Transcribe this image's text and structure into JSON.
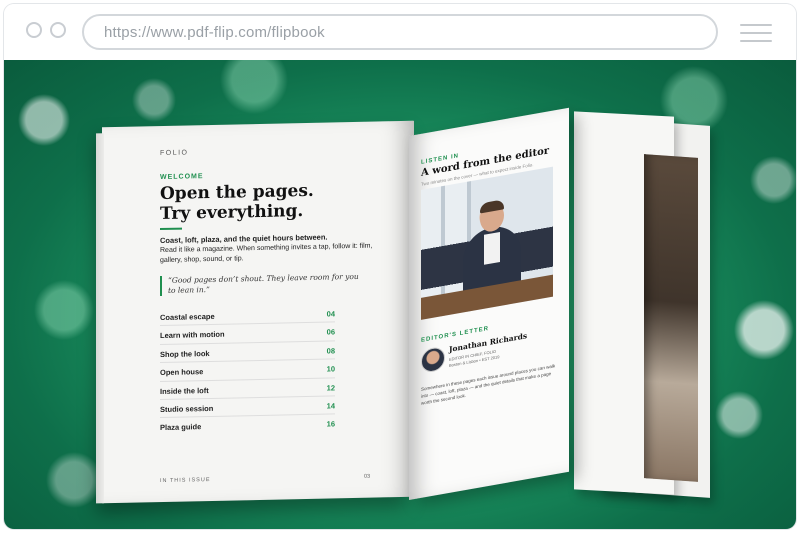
{
  "browser": {
    "url": "https://www.pdf-flip.com/flipbook"
  },
  "flipbook": {
    "left_page": {
      "brand": "FOLIO",
      "kicker": "WELCOME",
      "headline_line1": "Open the pages.",
      "headline_line2": "Try everything.",
      "deck_bold": "Coast, loft, plaza, and the quiet hours between.",
      "deck_body": "Read it like a magazine. When something invites a tap, follow it: film, gallery, shop, sound, or tip.",
      "quote": "“Good pages don’t shout. They leave room for you to lean in.”",
      "toc": [
        {
          "title": "Coastal escape",
          "page": "04"
        },
        {
          "title": "Learn with motion",
          "page": "06"
        },
        {
          "title": "Shop the look",
          "page": "08"
        },
        {
          "title": "Open house",
          "page": "10"
        },
        {
          "title": "Inside the loft",
          "page": "12"
        },
        {
          "title": "Studio session",
          "page": "14"
        },
        {
          "title": "Plaza guide",
          "page": "16"
        }
      ],
      "footer_label": "IN THIS ISSUE",
      "page_number": "03"
    },
    "right_page": {
      "kicker": "LISTEN IN",
      "title": "A word from the editor",
      "subtitle": "Two minutes on the cover — what to expect inside Folio.",
      "editors_kicker": "EDITOR'S LETTER",
      "editor_name": "Jonathan Richards",
      "editor_role": "EDITOR IN CHIEF, FOLIO",
      "editor_location": "Boston & Lisbon • EST 2019",
      "body": "Somewhere in these pages each issue around places you can walk into — coast, loft, plaza — and the quiet details that make a page worth the second look."
    }
  }
}
